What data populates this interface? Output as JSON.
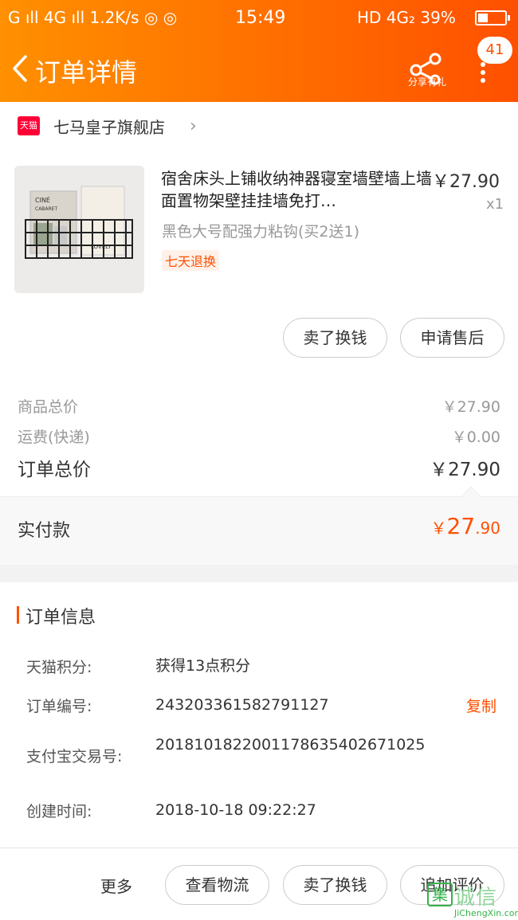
{
  "status_bar": {
    "left": "G ıll  4G ıll  1.2K/s ◎ ◎",
    "time": "15:49",
    "right": "HD 4G₂ 39%"
  },
  "nav": {
    "title": "订单详情",
    "share_label": "分享有礼",
    "badge_count": "41"
  },
  "shop": {
    "logo_text": "天猫",
    "name": "七马皇子旗舰店"
  },
  "product": {
    "image_texts": [
      "CINÉ",
      "CABARET",
      "LOVELY"
    ],
    "title": "宿舍床头上铺收纳神器寝室墙壁墙上墙面置物架壁挂挂墙免打…",
    "price": "￥27.90",
    "quantity": "x1",
    "spec": "黑色大号配强力粘钩(买2送1)",
    "tag": "七天退换",
    "buttons": [
      "卖了换钱",
      "申请售后"
    ]
  },
  "summary": {
    "goods_label": "商品总价",
    "goods_value": "￥27.90",
    "shipping_label": "运费(快递)",
    "shipping_value": "￥0.00",
    "total_label": "订单总价",
    "total_value": "￥27.90"
  },
  "payment": {
    "label": "实付款",
    "currency": "￥",
    "amount_int": "27",
    "amount_dec": ".90"
  },
  "order_info": {
    "title": "订单信息",
    "rows": [
      {
        "key": "天猫积分:",
        "value": "获得13点积分"
      },
      {
        "key": "订单编号:",
        "value": "243203361582791127"
      },
      {
        "key": "支付宝交易号:",
        "value": "2018101822001178635402671025"
      },
      {
        "key": "创建时间:",
        "value": "2018-10-18 09:22:27"
      }
    ],
    "copy_label": "复制"
  },
  "footer": {
    "more_label": "更多",
    "buttons": [
      "查看物流",
      "卖了换钱",
      "追加评价"
    ]
  },
  "watermark": {
    "mark": "集",
    "text": "诚信",
    "sub": "JiChengXin.com"
  },
  "colors": {
    "brand_orange": "#ff5000",
    "header_gradient_start": "#ff9000",
    "tmall_red": "#ff0036"
  }
}
